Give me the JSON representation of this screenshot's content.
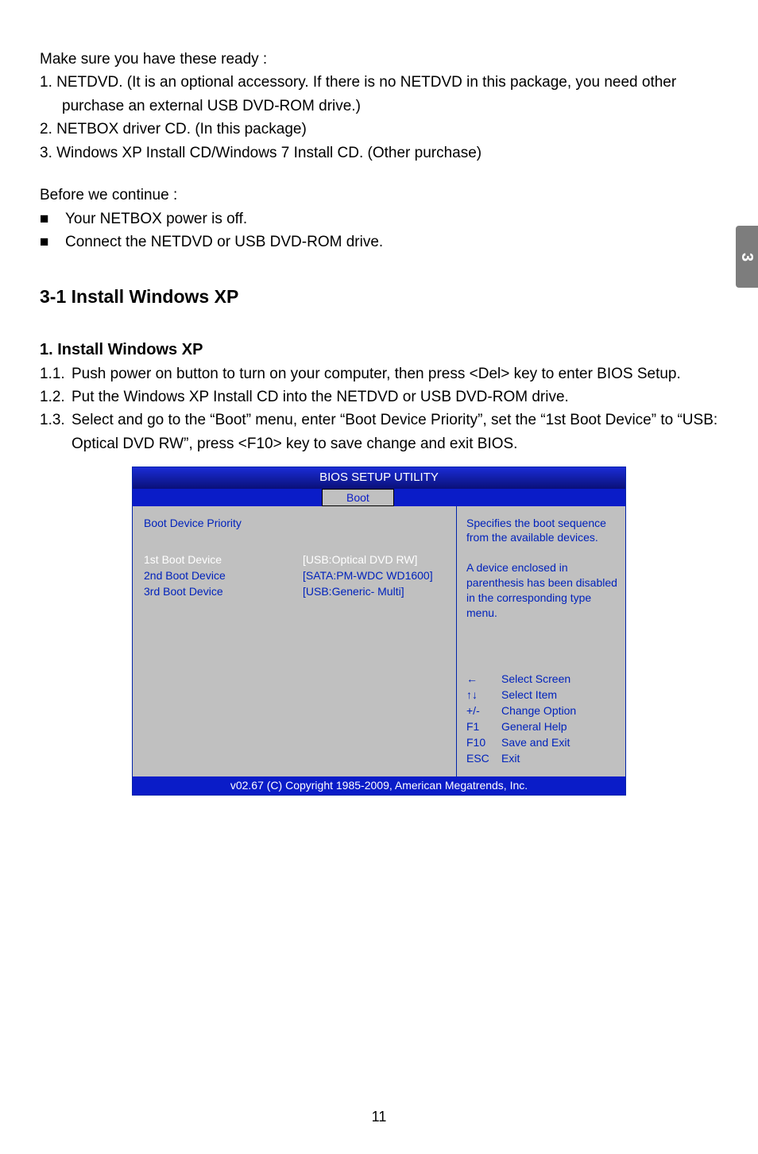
{
  "side_tab": "3",
  "intro": {
    "lead": "Make sure you have these ready :",
    "items": [
      "1. NETDVD. (It is an optional accessory. If there is no NETDVD in this package, you need other purchase an external USB DVD-ROM drive.)",
      "2. NETBOX driver CD. (In this package)",
      "3. Windows XP Install CD/Windows 7 Install CD. (Other purchase)"
    ]
  },
  "before": {
    "lead": "Before we continue :",
    "bullets": [
      "Your NETBOX power is off.",
      "Connect the NETDVD or USB DVD-ROM drive."
    ]
  },
  "h2": "3-1 Install Windows XP",
  "h3": "1. Install Windows XP",
  "steps": [
    {
      "n": "1.1.",
      "t": "Push power on button to turn on your computer, then press <Del> key to enter BIOS Setup."
    },
    {
      "n": "1.2.",
      "t": "Put the Windows XP Install CD into the NETDVD or USB DVD-ROM drive."
    },
    {
      "n": "1.3.",
      "t": "Select and go to the “Boot” menu, enter “Boot Device Priority”, set the “1st Boot Device” to “USB: Optical DVD RW”, press <F10> key to save change and exit BIOS."
    }
  ],
  "bios": {
    "title": "BIOS SETUP UTILITY",
    "active_tab": "Boot",
    "left_header": "Boot Device Priority",
    "rows": [
      {
        "label": "1st Boot Device",
        "value": "[USB:Optical DVD RW]",
        "highlight": true
      },
      {
        "label": "2nd Boot Device",
        "value": "[SATA:PM-WDC WD1600]",
        "highlight": false
      },
      {
        "label": "3rd Boot Device",
        "value": "[USB:Generic- Multi]",
        "highlight": false
      }
    ],
    "help_top": "Specifies the boot sequence from the available devices.\n\nA device enclosed in parenthesis has been disabled in the corresponding type menu.",
    "help_keys": [
      {
        "k": "←",
        "d": "Select Screen"
      },
      {
        "k": "↑↓",
        "d": "Select Item"
      },
      {
        "k": "+/-",
        "d": "Change Option"
      },
      {
        "k": "F1",
        "d": "General Help"
      },
      {
        "k": "F10",
        "d": "Save and Exit"
      },
      {
        "k": "ESC",
        "d": "Exit"
      }
    ],
    "footer": "v02.67 (C) Copyright 1985-2009, American Megatrends, Inc."
  },
  "page_number": "11"
}
